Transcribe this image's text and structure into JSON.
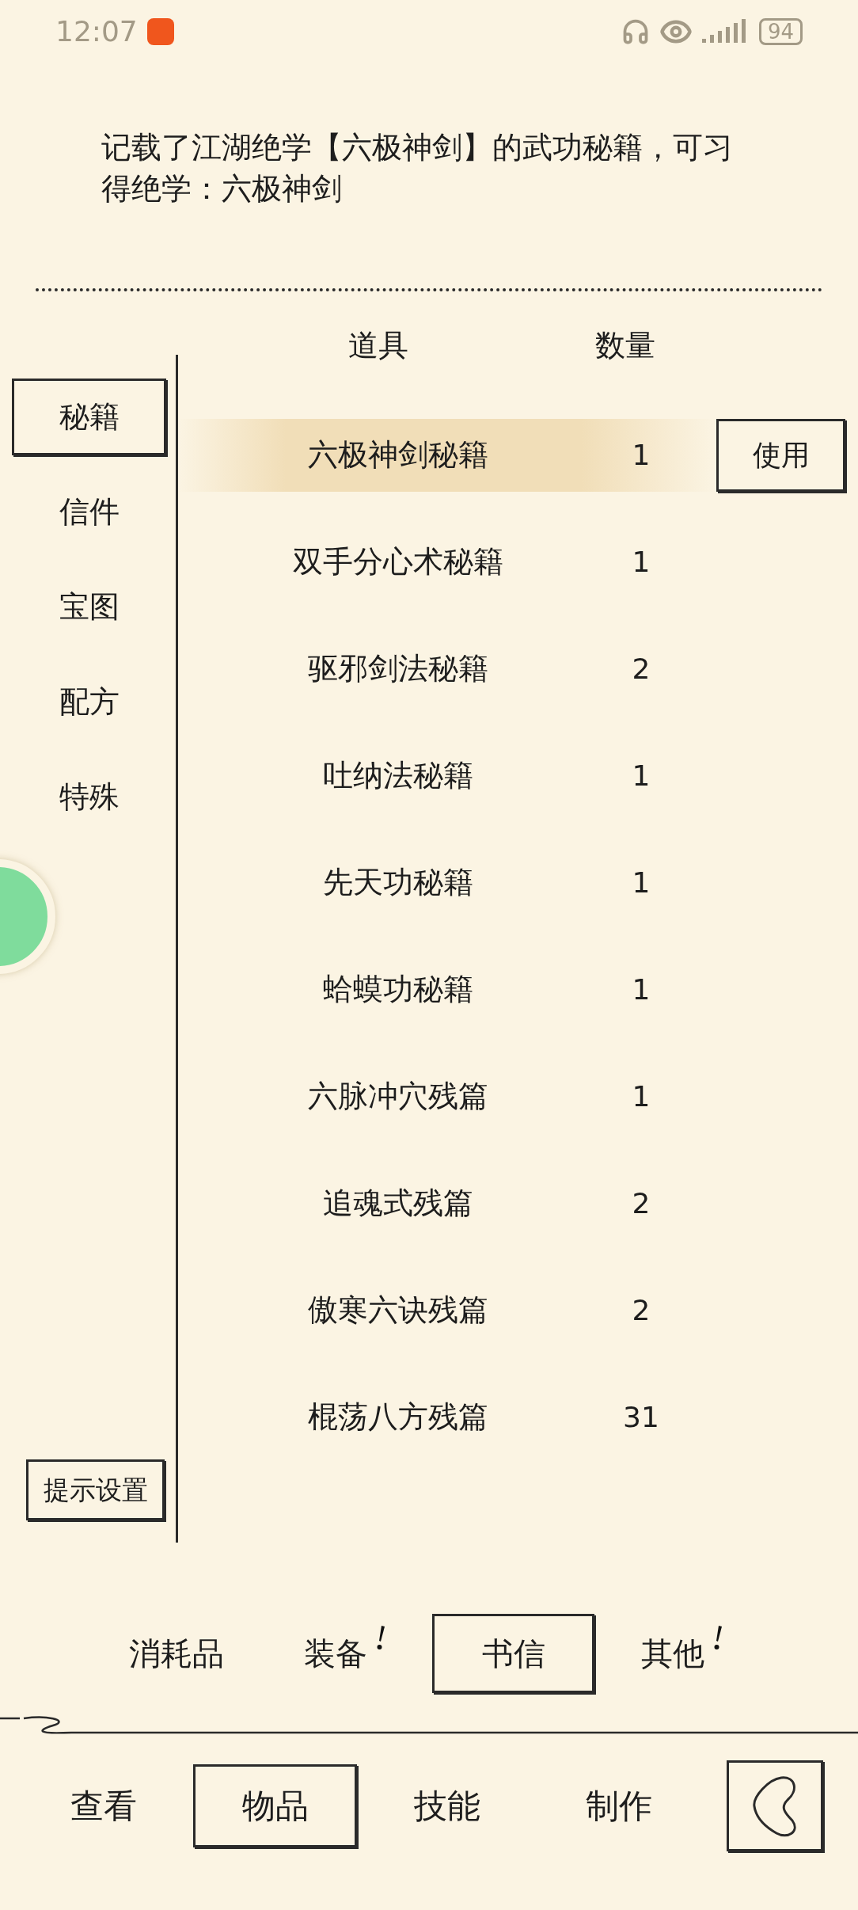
{
  "status_bar": {
    "time": "12:07",
    "battery": "94"
  },
  "description": "记载了江湖绝学【六极神剑】的武功秘籍，可习得绝学：六极神剑",
  "columns": [
    "道具",
    "数量"
  ],
  "categories": [
    {
      "label": "秘籍",
      "selected": true
    },
    {
      "label": "信件",
      "selected": false
    },
    {
      "label": "宝图",
      "selected": false
    },
    {
      "label": "配方",
      "selected": false
    },
    {
      "label": "特殊",
      "selected": false
    }
  ],
  "hint_settings_button": "提示设置",
  "rows": [
    {
      "name": "六极神剑秘籍",
      "quantity": "1",
      "selected": true
    },
    {
      "name": "双手分心术秘籍",
      "quantity": "1",
      "selected": false
    },
    {
      "name": "驱邪剑法秘籍",
      "quantity": "2",
      "selected": false
    },
    {
      "name": "吐纳法秘籍",
      "quantity": "1",
      "selected": false
    },
    {
      "name": "先天功秘籍",
      "quantity": "1",
      "selected": false
    },
    {
      "name": "蛤蟆功秘籍",
      "quantity": "1",
      "selected": false
    },
    {
      "name": "六脉冲穴残篇",
      "quantity": "1",
      "selected": false
    },
    {
      "name": "追魂式残篇",
      "quantity": "2",
      "selected": false
    },
    {
      "name": "傲寒六诀残篇",
      "quantity": "2",
      "selected": false
    },
    {
      "name": "棍荡八方残篇",
      "quantity": "31",
      "selected": false
    }
  ],
  "use_button": "使用",
  "sub_tabs": [
    {
      "label": "消耗品",
      "selected": false,
      "alert": false
    },
    {
      "label": "装备",
      "selected": false,
      "alert": true
    },
    {
      "label": "书信",
      "selected": true,
      "alert": false
    },
    {
      "label": "其他",
      "selected": false,
      "alert": true
    }
  ],
  "nav_tabs": [
    {
      "label": "查看",
      "selected": false
    },
    {
      "label": "物品",
      "selected": true
    },
    {
      "label": "技能",
      "selected": false
    },
    {
      "label": "制作",
      "selected": false
    }
  ]
}
